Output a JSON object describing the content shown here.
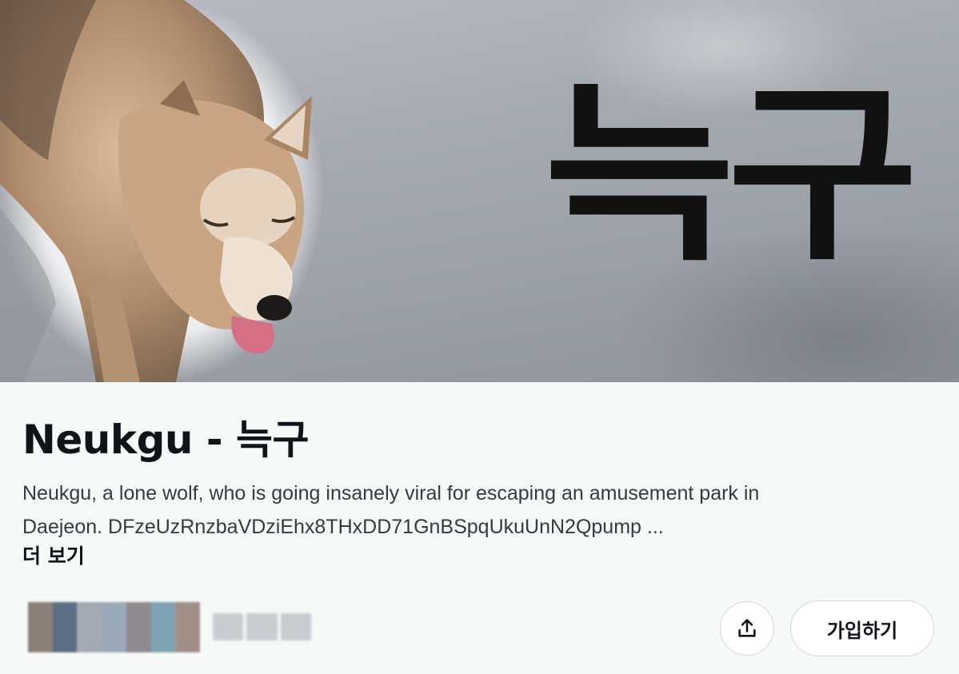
{
  "banner": {
    "text": "늑구"
  },
  "community": {
    "title": "Neukgu - 늑구",
    "description_line1": "Neukgu, a lone wolf, who is going insanely viral for escaping an amusement park in",
    "description_line2": "Daejeon. DFzeUzRnzbaVDziEhx8THxDD71GnBSpqUkuUnN2Qpump ...",
    "more_label": "더 보기"
  },
  "members": {
    "avatar_colors": [
      "#8a7f78",
      "#5d6e86",
      "#a4a9b4",
      "#9aa9b8",
      "#8e8a8e",
      "#7ea3b4",
      "#a08f86"
    ]
  },
  "actions": {
    "share_icon": "share-upload-icon",
    "join_label": "가입하기"
  }
}
